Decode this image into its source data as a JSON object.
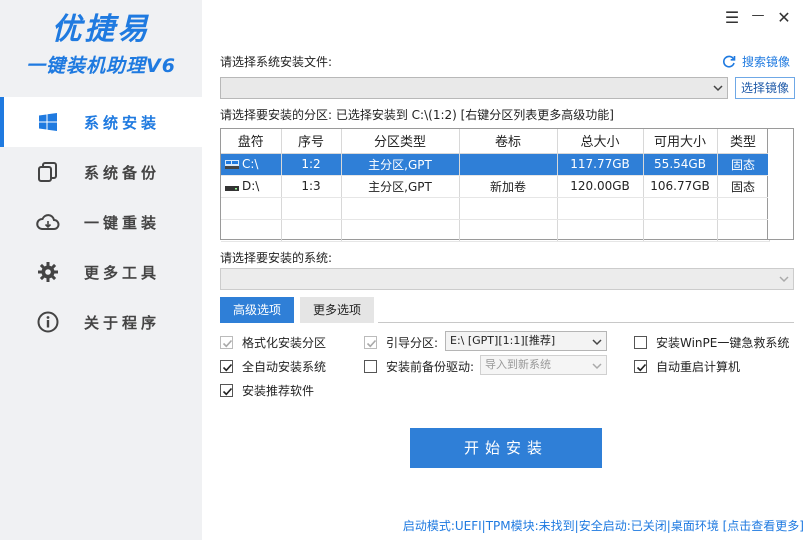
{
  "brand": {
    "title": "优捷易",
    "subtitle": "一键装机助理V6",
    "color": "#1f7ae0"
  },
  "window_controls": {
    "menu": "☰",
    "minimize": "—",
    "close": "✕"
  },
  "sidebar": {
    "items": [
      {
        "label": "系统安装",
        "icon": "windows-icon",
        "active": true
      },
      {
        "label": "系统备份",
        "icon": "copy-icon",
        "active": false
      },
      {
        "label": "一键重装",
        "icon": "cloud-icon",
        "active": false
      },
      {
        "label": "更多工具",
        "icon": "gear-icon",
        "active": false
      },
      {
        "label": "关于程序",
        "icon": "info-icon",
        "active": false
      }
    ]
  },
  "image_file": {
    "label": "请选择系统安装文件:",
    "search_label": "搜索镜像",
    "value": "",
    "browse_label": "选择镜像"
  },
  "partition": {
    "label": "请选择要安装的分区: 已选择安装到 C:\\(1:2) [右键分区列表更多高级功能]",
    "columns": [
      "盘符",
      "序号",
      "分区类型",
      "卷标",
      "总大小",
      "可用大小",
      "类型"
    ],
    "rows": [
      {
        "drive": "C:\\",
        "index": "1:2",
        "part_type": "主分区,GPT",
        "volume": "",
        "total": "117.77GB",
        "free": "55.54GB",
        "kind": "固态",
        "selected": true
      },
      {
        "drive": "D:\\",
        "index": "1:3",
        "part_type": "主分区,GPT",
        "volume": "新加卷",
        "total": "120.00GB",
        "free": "106.77GB",
        "kind": "固态",
        "selected": false
      }
    ]
  },
  "system": {
    "label": "请选择要安装的系统:",
    "value": ""
  },
  "tabs": [
    {
      "label": "高级选项",
      "active": true
    },
    {
      "label": "更多选项",
      "active": false
    }
  ],
  "options": {
    "format_partition": {
      "label": "格式化安装分区",
      "checked": true,
      "disabled": true
    },
    "boot_partition": {
      "label": "引导分区:",
      "checked": true,
      "disabled": true,
      "select_value": "E:\\ [GPT][1:1][推荐]"
    },
    "install_winpe": {
      "label": "安装WinPE一键急救系统",
      "checked": false
    },
    "auto_install": {
      "label": "全自动安装系统",
      "checked": true
    },
    "backup_drivers": {
      "label": "安装前备份驱动:",
      "checked": false,
      "select_value": "导入到新系统"
    },
    "auto_restart": {
      "label": "自动重启计算机",
      "checked": true
    },
    "install_recommended": {
      "label": "安装推荐软件",
      "checked": true
    }
  },
  "start_button": "开始安装",
  "status_bar": "启动模式:UEFI|TPM模块:未找到|安全启动:已关闭|桌面环境 [点击查看更多]"
}
